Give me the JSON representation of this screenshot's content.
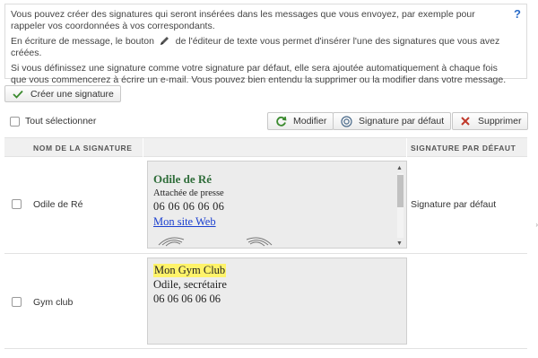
{
  "info": {
    "line1": "Vous pouvez créer des signatures qui seront insérées dans les messages que vous envoyez, par exemple pour rappeler vos coordonnées à vos correspondants.",
    "line2_before": "En écriture de message, le bouton",
    "line2_after": "de l'éditeur de texte vous permet d'insérer l'une des signatures que vous avez créées.",
    "line3": "Si vous définissez une signature comme votre signature par défaut, elle sera ajoutée automatiquement à chaque fois que vous commencerez à écrire un e-mail. Vous pouvez bien entendu la supprimer ou la modifier dans votre message.",
    "help": "?"
  },
  "toolbar": {
    "create_label": "Créer une signature",
    "select_all_label": "Tout sélectionner",
    "modify_label": "Modifier",
    "default_label": "Signature par défaut",
    "delete_label": "Supprimer"
  },
  "table": {
    "col_name": "NOM DE LA SIGNATURE",
    "col_default": "SIGNATURE PAR DÉFAUT",
    "rows": [
      {
        "name": "Odile de Ré",
        "default": "Signature par défaut",
        "preview": {
          "title": "Odile de Ré",
          "subtitle": "Attachée de presse",
          "phone": "06 06 06 06 06",
          "link": "Mon site Web"
        }
      },
      {
        "name": "Gym club",
        "default": "",
        "preview": {
          "title": "Mon Gym Club",
          "subtitle": "Odile, secrétaire",
          "phone": "06 06 06 06 06"
        }
      }
    ]
  },
  "colors": {
    "check": "#3a8a2e",
    "modify": "#3a8a2e",
    "delete": "#c0392b",
    "link": "#1a3fcf",
    "highlight": "#fff36a"
  }
}
